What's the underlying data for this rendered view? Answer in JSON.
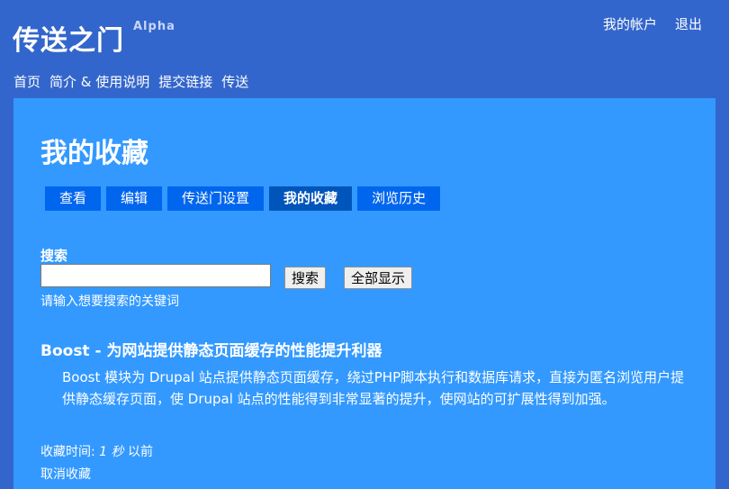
{
  "header": {
    "site_name": "传送之门",
    "badge": "Alpha",
    "user_links": {
      "account": "我的帐户",
      "logout": "退出"
    }
  },
  "nav": {
    "home": "首页",
    "about": "简介 & 使用说明",
    "submit": "提交链接",
    "send": "传送"
  },
  "page": {
    "title": "我的收藏",
    "tabs": {
      "view": "查看",
      "edit": "编辑",
      "settings": "传送门设置",
      "favorites": "我的收藏",
      "history": "浏览历史"
    },
    "active_tab": "favorites"
  },
  "search": {
    "label": "搜索",
    "value": "",
    "placeholder": "",
    "search_button": "搜索",
    "show_all_button": "全部显示",
    "description": "请输入想要搜索的关键词"
  },
  "favorites": [
    {
      "title": "Boost - 为网站提供静态页面缓存的性能提升利器",
      "body": "Boost 模块为 Drupal 站点提供静态页面缓存，绕过PHP脚本执行和数据库请求，直接为匿名浏览用户提供静态缓存页面，使 Drupal 站点的性能得到非常显著的提升，使网站的可扩展性得到加强。",
      "time_label": "收藏时间:",
      "time_value": "1 秒",
      "time_suffix": "以前",
      "remove_label": "取消收藏"
    }
  ],
  "colors": {
    "page_bg": "#3366cc",
    "content_bg": "#3399ff",
    "tab_bg": "#0066ee",
    "tab_active_bg": "#0055bb"
  }
}
